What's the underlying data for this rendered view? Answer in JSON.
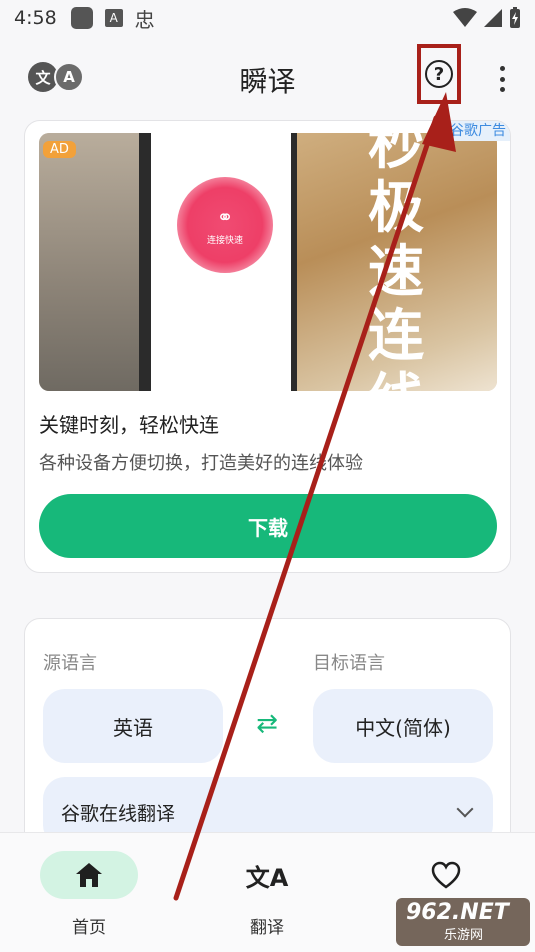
{
  "status_bar": {
    "time": "4:58",
    "a_label": "A",
    "bug_glyph": "忠"
  },
  "app_bar": {
    "logo_left": "文",
    "logo_right": "A",
    "title": "瞬译",
    "help_glyph": "?"
  },
  "ad": {
    "badge": "AD",
    "source": "谷歌广告",
    "ring_label": "连接快速",
    "big_text": "秒极速连线",
    "title": "关键时刻，轻松快连",
    "description": "各种设备方便切换，打造美好的连线体验",
    "button_label": "下载"
  },
  "translator": {
    "source_label": "源语言",
    "target_label": "目标语言",
    "source_lang": "英语",
    "target_lang": "中文(简体)",
    "swap_glyph": "⇄",
    "engine": "谷歌在线翻译"
  },
  "bottom_nav": {
    "items": [
      {
        "label": "首页",
        "icon": "home-icon",
        "active": true
      },
      {
        "label": "翻译",
        "icon": "translate-icon",
        "active": false
      },
      {
        "label": "",
        "icon": "heart-icon",
        "active": false
      }
    ],
    "translate_glyph": "文A"
  },
  "watermark": {
    "line1": "962.NET",
    "line2": "乐游网"
  },
  "colors": {
    "accent": "#17b87a",
    "annotation": "#a8201a",
    "chip_bg": "#eaf0fb",
    "ad_badge": "#f2a13a"
  }
}
